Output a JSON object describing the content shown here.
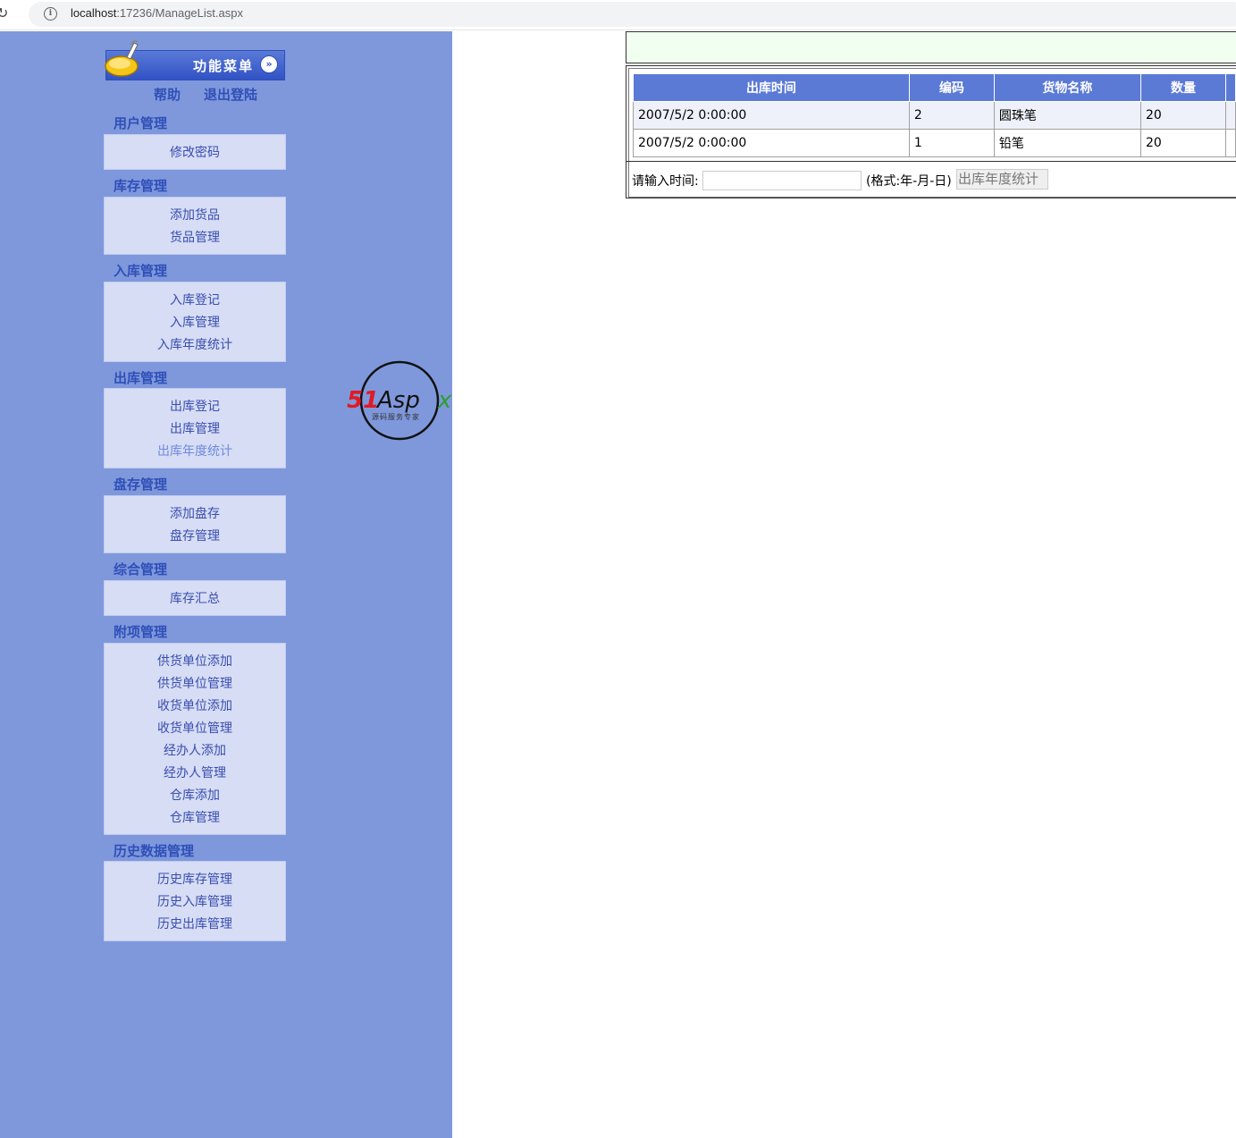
{
  "browser": {
    "url_host": "localhost",
    "url_path": ":17236/ManageList.aspx"
  },
  "menu": {
    "title": "功能菜单",
    "help": "帮助",
    "logout": "退出登陆"
  },
  "sections": [
    {
      "title": "用户管理",
      "items": [
        "修改密码"
      ]
    },
    {
      "title": "库存管理",
      "items": [
        "添加货品",
        "货品管理"
      ]
    },
    {
      "title": "入库管理",
      "items": [
        "入库登记",
        "入库管理",
        "入库年度统计"
      ]
    },
    {
      "title": "出库管理",
      "items": [
        "出库登记",
        "出库管理",
        "出库年度统计"
      ]
    },
    {
      "title": "盘存管理",
      "items": [
        "添加盘存",
        "盘存管理"
      ]
    },
    {
      "title": "综合管理",
      "items": [
        "库存汇总"
      ]
    },
    {
      "title": "附项管理",
      "items": [
        "供货单位添加",
        "供货单位管理",
        "收货单位添加",
        "收货单位管理",
        "经办人添加",
        "经办人管理",
        "仓库添加",
        "仓库管理"
      ]
    },
    {
      "title": "历史数据管理",
      "items": [
        "历史库存管理",
        "历史入库管理",
        "历史出库管理"
      ]
    }
  ],
  "watermark": {
    "brand": "51Aspx",
    "tagline": "源码服务专家"
  },
  "grid": {
    "headers": [
      "出库时间",
      "编码",
      "货物名称",
      "数量"
    ],
    "rows": [
      [
        "2007/5/2 0:00:00",
        "2",
        "圆珠笔",
        "20"
      ],
      [
        "2007/5/2 0:00:00",
        "1",
        "铅笔",
        "20"
      ]
    ]
  },
  "query": {
    "label": "请输入时间:",
    "input_value": "",
    "format_hint": "(格式:年-月-日)",
    "button": "出库年度统计"
  },
  "colors": {
    "sidebar_bg": "#7f98dc",
    "menu_link": "#3a4db0",
    "header_bg": "#5b7ad6",
    "topbar_bg": "#f0fff0"
  }
}
